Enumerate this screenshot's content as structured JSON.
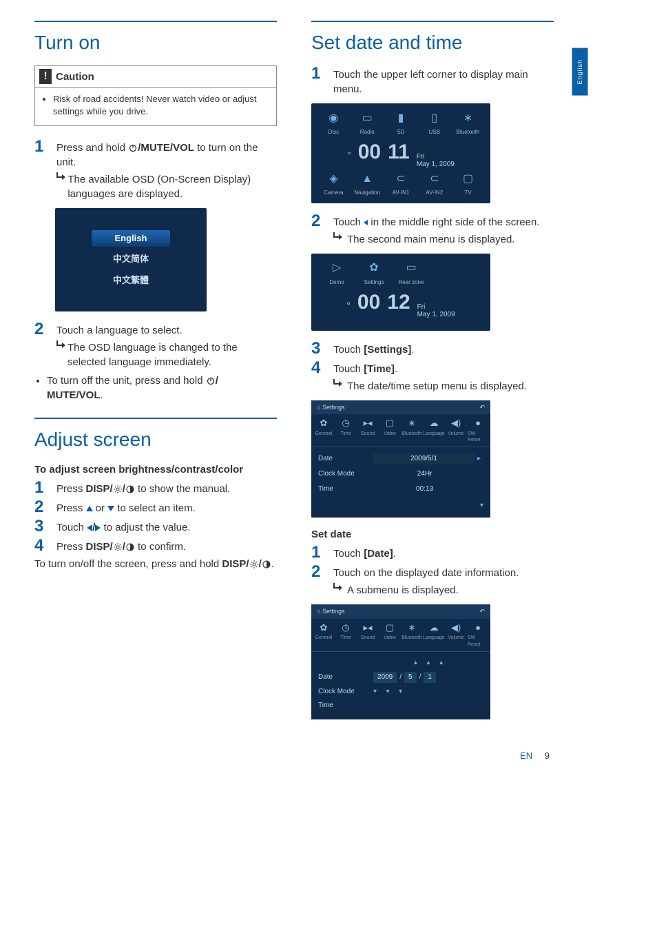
{
  "side_tab": "English",
  "footer": {
    "lang": "EN",
    "page": "9"
  },
  "left": {
    "turn_on": {
      "title": "Turn on",
      "caution_label": "Caution",
      "caution_text": "Risk of road accidents! Never watch video or adjust settings while you drive.",
      "step1_a": "Press and hold ",
      "step1_b": "/MUTE/VOL",
      "step1_c": " to turn on the unit.",
      "step1_result": "The available OSD (On-Screen Display) languages are displayed.",
      "lang_opts": [
        "English",
        "中文简体",
        "中文繁體"
      ],
      "step2": "Touch a language to select.",
      "step2_result": "The OSD language is changed to the selected language immediately.",
      "note_a": "To turn off the unit, press and hold ",
      "note_b": "/ MUTE/VOL",
      "note_c": "."
    },
    "adjust": {
      "title": "Adjust screen",
      "subhead": "To adjust screen brightness/contrast/color",
      "s1_a": "Press ",
      "s1_b": "DISP/",
      "s1_c": " to show the manual.",
      "s2_a": "Press ",
      "s2_b": " or ",
      "s2_c": " to select an item.",
      "s3_a": "Touch ",
      "s3_b": " to adjust the value.",
      "s4_a": "Press ",
      "s4_b": "DISP/",
      "s4_c": " to confirm.",
      "tail_a": "To turn on/off the screen, press and hold ",
      "tail_b": "DISP/",
      "tail_c": "."
    }
  },
  "right": {
    "title": "Set date and time",
    "s1": "Touch the upper left corner to display main menu.",
    "menu1_top": [
      "Disc",
      "Radio",
      "SD",
      "USB",
      "Bluetooth"
    ],
    "menu1_bottom": [
      "Camera",
      "Navigation",
      "AV-IN1",
      "AV-IN2",
      "TV"
    ],
    "clock1": {
      "h": "00",
      "m": "11",
      "day": "Fri",
      "date": "May 1, 2009"
    },
    "s2_a": "Touch ",
    "s2_b": " in the middle right side of the screen.",
    "s2_result": "The second main menu is displayed.",
    "menu2_top": [
      "Demo",
      "Settings",
      "Rear zone"
    ],
    "clock2": {
      "h": "00",
      "m": "12",
      "day": "Fri",
      "date": "May 1, 2009"
    },
    "s3_a": "Touch ",
    "s3_b": "[Settings]",
    "s3_c": ".",
    "s4_a": "Touch ",
    "s4_b": "[Time]",
    "s4_c": ".",
    "s4_result": "The date/time setup menu is displayed.",
    "settings_header": "Settings",
    "settings_tabs": [
      "General",
      "Time",
      "Sound",
      "Video",
      "Bluetooth",
      "Language",
      "Volume",
      "SW Reset"
    ],
    "settings_rows": {
      "date_label": "Date",
      "date_value": "2009/5/1",
      "clockmode_label": "Clock Mode",
      "clockmode_value": "24Hr",
      "time_label": "Time",
      "time_value": "00:13"
    },
    "setdate_sub": "Set date",
    "sd1_a": "Touch ",
    "sd1_b": "[Date]",
    "sd1_c": ".",
    "sd2": "Touch on the displayed date information.",
    "sd2_result": "A submenu is displayed.",
    "date_fig": {
      "y": "2009",
      "m": "5",
      "d": "1"
    }
  }
}
